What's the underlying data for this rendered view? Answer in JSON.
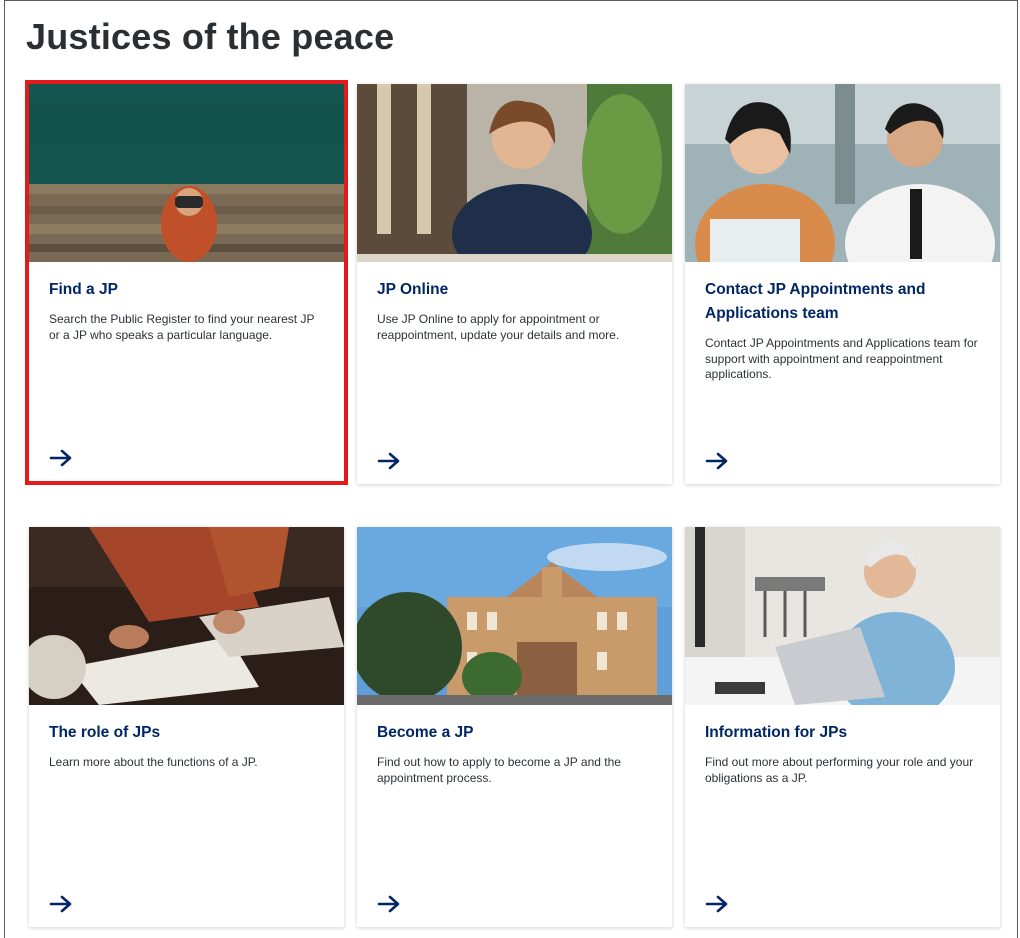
{
  "page": {
    "title": "Justices of the peace"
  },
  "cards": [
    {
      "title": "Find a JP",
      "description": "Search the Public Register to find your nearest JP or a JP who speaks a particular language.",
      "image_alt": "binoculars-photo",
      "selected": true
    },
    {
      "title": "JP Online",
      "description": "Use JP Online to apply for appointment or reappointment, update your details and more.",
      "image_alt": "smiling-woman-photo",
      "selected": false
    },
    {
      "title": "Contact JP Appointments and Applications team",
      "description": "Contact JP Appointments and Applications team for support with appointment and reappointment applications.",
      "image_alt": "call-centre-photo",
      "selected": false
    },
    {
      "title": "The role of JPs",
      "description": "Learn more about the functions of a JP.",
      "image_alt": "signing-document-photo",
      "selected": false
    },
    {
      "title": "Become a JP",
      "description": "Find out how to apply to become a JP and the appointment process.",
      "image_alt": "historic-building-photo",
      "selected": false
    },
    {
      "title": "Information for JPs",
      "description": "Find out more about performing your role and your obligations as a JP.",
      "image_alt": "man-at-laptop-photo",
      "selected": false
    }
  ],
  "colors": {
    "title_blue": "#002664",
    "selection_red": "#e4191a",
    "heading": "#2a2f33"
  }
}
